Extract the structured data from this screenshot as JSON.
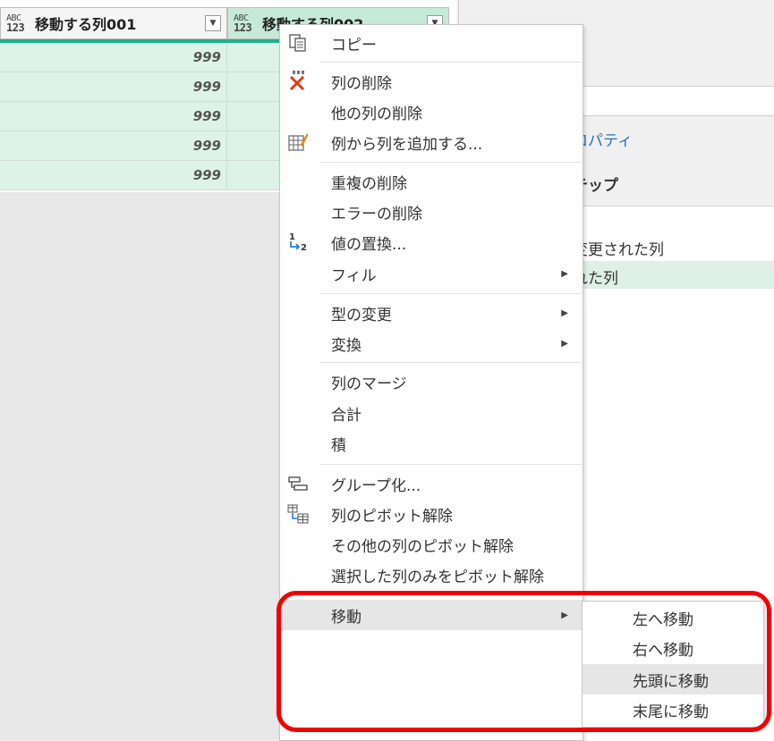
{
  "grid": {
    "columns": [
      {
        "type_top": "ABC",
        "type_bottom": "123",
        "name": "移動する列001"
      },
      {
        "type_top": "ABC",
        "type_bottom": "123",
        "name": "移動する列002"
      }
    ],
    "rows": [
      [
        "999",
        ""
      ],
      [
        "999",
        ""
      ],
      [
        "999",
        ""
      ],
      [
        "999",
        ""
      ],
      [
        "999",
        ""
      ]
    ]
  },
  "right_panel": {
    "properties_label": "ロパティ",
    "steps_label": "テップ",
    "steps": [
      "変更された列",
      "れた列"
    ]
  },
  "context_menu": {
    "items": [
      {
        "label": "コピー",
        "icon": "copy-icon"
      },
      {
        "label": "列の削除",
        "icon": "delete-column-icon"
      },
      {
        "label": "他の列の削除",
        "icon": ""
      },
      {
        "label": "例から列を追加する...",
        "icon": "column-from-examples-icon"
      },
      {
        "label": "重複の削除",
        "icon": ""
      },
      {
        "label": "エラーの削除",
        "icon": ""
      },
      {
        "label": "値の置換...",
        "icon": "replace-values-icon",
        "icon_text_1": "1",
        "icon_text_2": "2"
      },
      {
        "label": "フィル",
        "icon": "",
        "submenu": true
      },
      {
        "label": "型の変更",
        "icon": "",
        "submenu": true
      },
      {
        "label": "変換",
        "icon": "",
        "submenu": true
      },
      {
        "label": "列のマージ",
        "icon": ""
      },
      {
        "label": "合計",
        "icon": ""
      },
      {
        "label": "積",
        "icon": ""
      },
      {
        "label": "グループ化...",
        "icon": "group-by-icon"
      },
      {
        "label": "列のピボット解除",
        "icon": "unpivot-icon"
      },
      {
        "label": "その他の列のピボット解除",
        "icon": ""
      },
      {
        "label": "選択した列のみをピボット解除",
        "icon": ""
      },
      {
        "label": "移動",
        "icon": "",
        "submenu": true,
        "highlighted": true
      }
    ]
  },
  "move_submenu": {
    "items": [
      {
        "label": "左へ移動"
      },
      {
        "label": "右へ移動"
      },
      {
        "label": "先頭に移動",
        "highlighted": true
      },
      {
        "label": "末尾に移動"
      }
    ]
  },
  "colors": {
    "accent": "#1fb08f",
    "selected_column": "#c6e9d8",
    "highlight_border": "#f20000",
    "link_text": "#2c6eb5"
  }
}
